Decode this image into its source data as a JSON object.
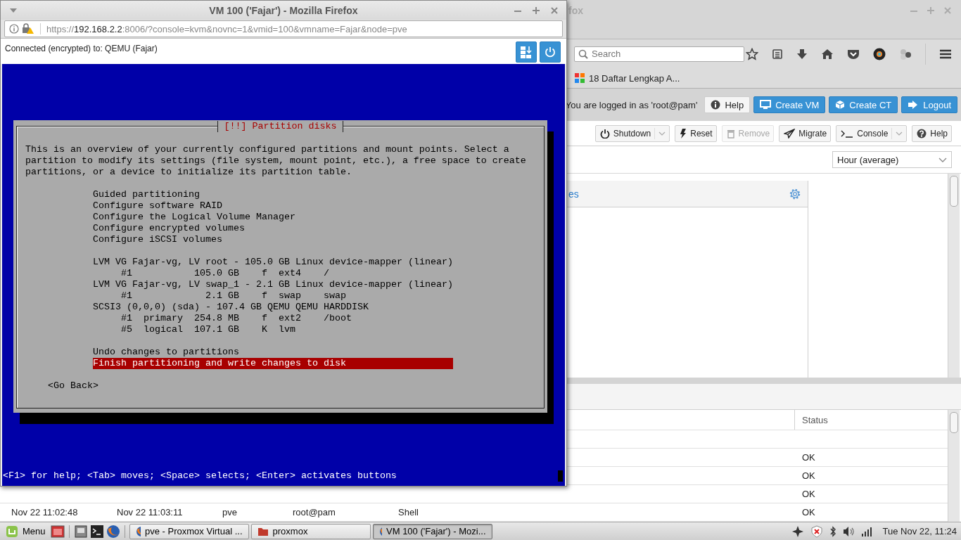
{
  "background_window": {
    "title": "fox",
    "search": {
      "placeholder": "Search"
    },
    "bookmarks": [
      {
        "label": "18 Daftar Lengkap A..."
      }
    ]
  },
  "proxmox": {
    "login_text": "You are logged in as 'root@pam'",
    "header_buttons": [
      {
        "label": "Help",
        "kind": "plain"
      },
      {
        "label": "Create VM",
        "kind": "primary"
      },
      {
        "label": "Create CT",
        "kind": "primary"
      },
      {
        "label": "Logout",
        "kind": "primary"
      }
    ],
    "toolbar": [
      {
        "label": "Shutdown",
        "disabled": false,
        "dropdown": true
      },
      {
        "label": "Reset",
        "disabled": false,
        "dropdown": false
      },
      {
        "label": "Remove",
        "disabled": true,
        "dropdown": false
      },
      {
        "label": "Migrate",
        "disabled": false,
        "dropdown": false
      },
      {
        "label": "Console",
        "disabled": false,
        "dropdown": true
      },
      {
        "label": "Help",
        "disabled": false,
        "dropdown": false
      }
    ],
    "timeframe": {
      "value": "Hour (average)"
    },
    "panel": {
      "title": "es"
    },
    "tasks": {
      "status_header": "Status",
      "rows": [
        {
          "status": "OK"
        },
        {
          "status": "OK"
        },
        {
          "status": "OK"
        },
        {
          "column_1": "Nov 22 11:02:48",
          "column_2": "Nov 22 11:03:11",
          "column_3": "pve",
          "column_4": "root@pam",
          "column_5": "Shell",
          "status": "OK"
        }
      ]
    }
  },
  "popup": {
    "title": "VM 100 ('Fajar') - Mozilla Firefox",
    "url": {
      "scheme": "https://",
      "host": "192.168.2.2",
      "rest": ":8006/?console=kvm&novnc=1&vmid=100&vmname=Fajar&node=pve"
    },
    "status": "Connected (encrypted) to: QEMU (Fajar)",
    "console": {
      "dialog_title": "[!!] Partition disks",
      "intro": [
        "This is an overview of your currently configured partitions and mount points. Select a",
        "partition to modify its settings (file system, mount point, etc.), a free space to create",
        "partitions, or a device to initialize its partition table."
      ],
      "sections": [
        [
          {
            "text": "Guided partitioning",
            "selected": false
          },
          {
            "text": "Configure software RAID",
            "selected": false
          },
          {
            "text": "Configure the Logical Volume Manager",
            "selected": false
          },
          {
            "text": "Configure encrypted volumes",
            "selected": false
          },
          {
            "text": "Configure iSCSI volumes",
            "selected": false
          }
        ],
        [
          {
            "text": "LVM VG Fajar-vg, LV root - 105.0 GB Linux device-mapper (linear)",
            "selected": false
          },
          {
            "text": "     #1           105.0 GB    f  ext4    /",
            "selected": false
          },
          {
            "text": "LVM VG Fajar-vg, LV swap_1 - 2.1 GB Linux device-mapper (linear)",
            "selected": false
          },
          {
            "text": "     #1             2.1 GB    f  swap    swap",
            "selected": false
          },
          {
            "text": "SCSI3 (0,0,0) (sda) - 107.4 GB QEMU QEMU HARDDISK",
            "selected": false
          },
          {
            "text": "     #1  primary  254.8 MB    f  ext2    /boot",
            "selected": false
          },
          {
            "text": "     #5  logical  107.1 GB    K  lvm",
            "selected": false
          }
        ],
        [
          {
            "text": "Undo changes to partitions",
            "selected": false
          },
          {
            "text": "Finish partitioning and write changes to disk",
            "selected": true
          }
        ]
      ],
      "back_button": "<Go Back>",
      "help_line": "<F1> for help; <Tab> moves; <Space> selects; <Enter> activates buttons"
    }
  },
  "taskbar": {
    "menu": "Menu",
    "tasks": [
      {
        "label": "pve - Proxmox Virtual ...",
        "selected": false
      },
      {
        "label": "proxmox",
        "selected": false
      },
      {
        "label": "VM 100 ('Fajar') - Mozi...",
        "selected": true
      }
    ],
    "clock": "Tue Nov 22, 11:24"
  }
}
